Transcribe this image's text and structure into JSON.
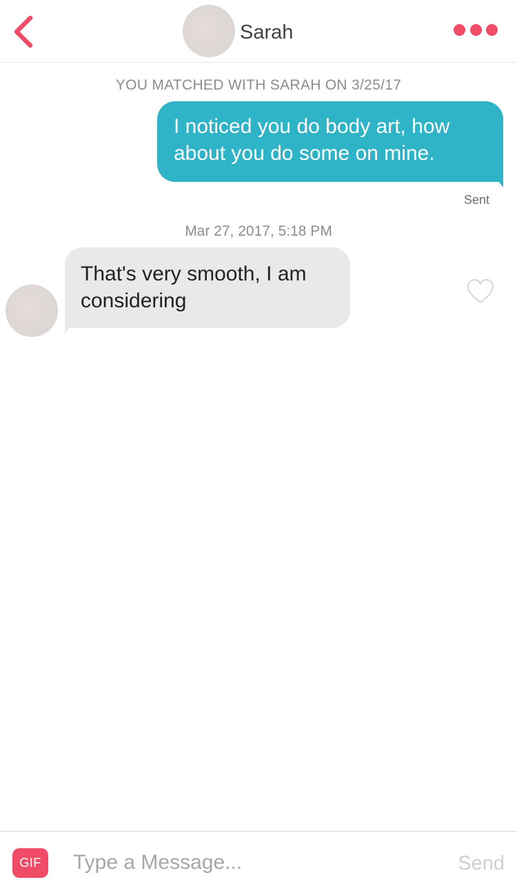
{
  "header": {
    "contact_name": "Sarah",
    "back_icon": "chevron-left-icon",
    "more_icon": "more-dots-icon",
    "accent_color": "#f04c67"
  },
  "conversation": {
    "match_note": "YOU MATCHED WITH SARAH ON 3/25/17",
    "outgoing": {
      "text": "I noticed you do body art, how about you do some on mine.",
      "status": "Sent",
      "bubble_color": "#2fb3c7"
    },
    "timestamp": "Mar 27, 2017, 5:18 PM",
    "incoming": {
      "text": "That's very smooth, I am considering",
      "bubble_color": "#e9e9e9",
      "like_icon": "heart-outline-icon"
    }
  },
  "composer": {
    "gif_label": "GIF",
    "placeholder": "Type a Message...",
    "value": "",
    "send_label": "Send"
  }
}
